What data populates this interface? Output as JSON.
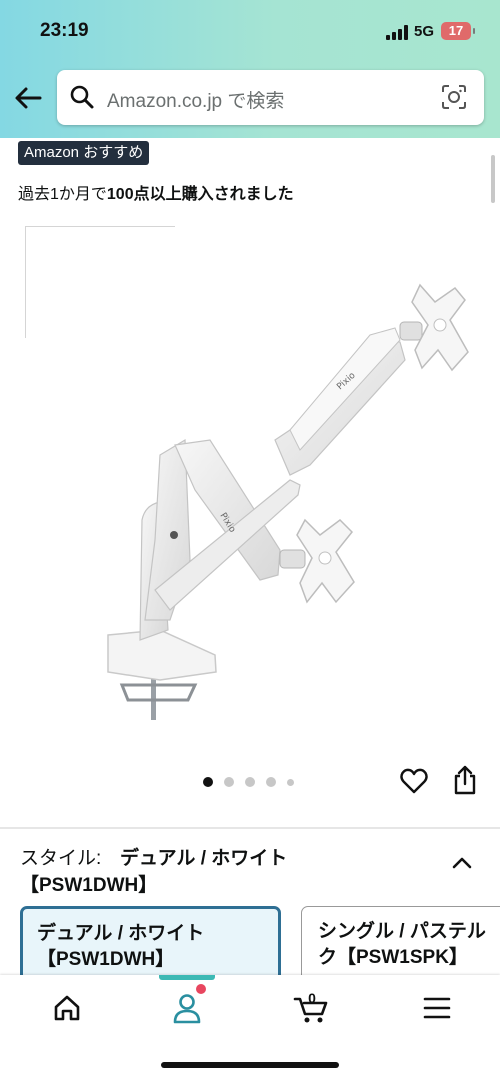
{
  "status_bar": {
    "time": "23:19",
    "network": "5G",
    "battery": "17"
  },
  "search": {
    "placeholder": "Amazon.co.jp で検索"
  },
  "product": {
    "badge": "Amazon おすすめ",
    "purchase_note_prefix": "過去1か月で",
    "purchase_note_bold": "100点以上購入されました",
    "image_description_icon": "monitor-arm-image",
    "carousel": {
      "total_dots": 5,
      "active_index": 0
    }
  },
  "variation": {
    "label": "スタイル:",
    "selected_value_line1": "デュアル / ホワイト",
    "selected_value_line2": "【PSW1DWH】",
    "options": [
      {
        "line1": "デュアル / ホワイト",
        "line2": "【PSW1DWH】",
        "selected": true
      },
      {
        "line1": "シングル / パステル",
        "line2": "ク【PSW1SPK】",
        "selected": false
      }
    ]
  },
  "bottom_nav": {
    "items": [
      {
        "icon": "home-icon"
      },
      {
        "icon": "account-icon"
      },
      {
        "icon": "cart-icon",
        "count": "0"
      },
      {
        "icon": "menu-icon"
      }
    ]
  },
  "colors": {
    "header_start": "#84d8e3",
    "header_end": "#a8e6cf",
    "selected_border": "#2e6f94",
    "selected_bg": "#e8f5fa",
    "nav_accent": "#3cb9b4",
    "notification": "#e8465f"
  }
}
